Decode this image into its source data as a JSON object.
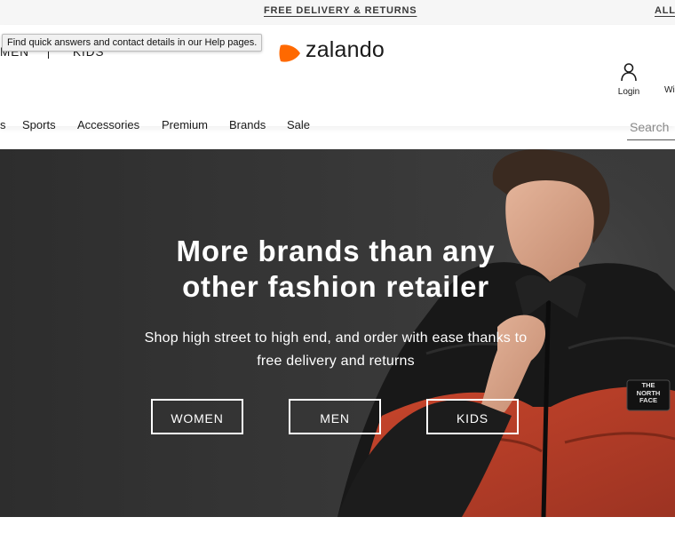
{
  "topbar": {
    "promo": "FREE DELIVERY & RETURNS",
    "right_link": "ALL"
  },
  "header": {
    "gender_links": [
      "MEN",
      "KIDS"
    ],
    "tooltip": "Find quick answers and contact details in our Help pages.",
    "logo_text": "zalando",
    "login_label": "Login",
    "wishlist_label": "Wi"
  },
  "nav": {
    "items": [
      "s",
      "Sports",
      "Accessories",
      "Premium",
      "Brands",
      "Sale"
    ]
  },
  "search": {
    "placeholder": "Search"
  },
  "hero": {
    "title_line1": "More brands than any",
    "title_line2": "other fashion retailer",
    "subtitle_line1": "Shop high street to high end, and order with ease thanks to",
    "subtitle_line2": "free delivery and returns",
    "buttons": [
      "WOMEN",
      "MEN",
      "KIDS"
    ],
    "jacket_patch": [
      "THE",
      "NORTH",
      "FACE"
    ]
  },
  "colors": {
    "brand_orange": "#ff6900",
    "hero_bg": "#333333",
    "jacket_red": "#b9412a"
  }
}
